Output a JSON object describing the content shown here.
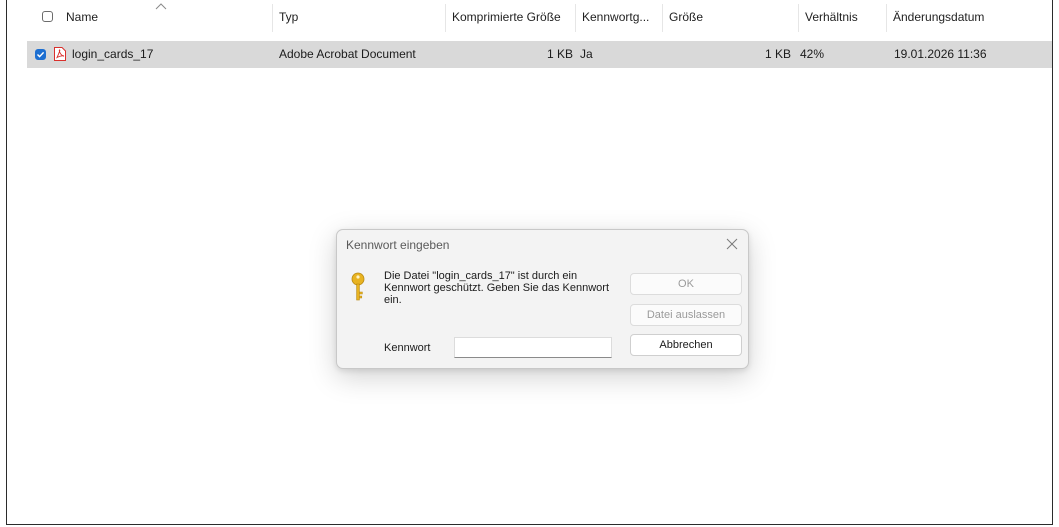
{
  "columns": {
    "name": "Name",
    "type": "Typ",
    "compressed_size": "Komprimierte Größe",
    "password": "Kennwortg...",
    "size": "Größe",
    "ratio": "Verhältnis",
    "modified": "Änderungsdatum"
  },
  "files": [
    {
      "name": "login_cards_17",
      "type": "Adobe Acrobat Document",
      "compressed_size": "1 KB",
      "password": "Ja",
      "size": "1 KB",
      "ratio": "42%",
      "modified": "19.01.2026 11:36",
      "checked": true,
      "icon": "pdf-icon"
    }
  ],
  "dialog": {
    "title": "Kennwort eingeben",
    "message": "Die Datei \"login_cards_17\" ist durch ein Kennwort geschützt. Geben Sie das Kennwort ein.",
    "password_label": "Kennwort",
    "password_value": "",
    "ok_label": "OK",
    "skip_label": "Datei auslassen",
    "cancel_label": "Abbrechen",
    "icon": "key-icon"
  },
  "colors": {
    "selection": "#d9d9d9",
    "checkbox_accent": "#1d6fd1",
    "pdf_red": "#d9302c",
    "key_gold": "#e8b321"
  }
}
